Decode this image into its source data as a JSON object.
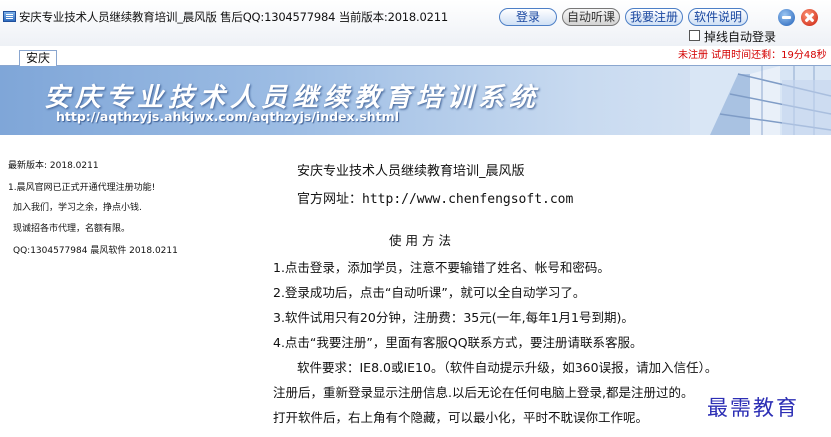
{
  "window": {
    "title": "安庆专业技术人员继续教育培训_晨风版 售后QQ:1304577984 当前版本:2018.0211"
  },
  "toolbar": {
    "login_label": "登录",
    "auto_listen_label": "自动听课",
    "register_label": "我要注册",
    "manual_label": "软件说明"
  },
  "options": {
    "auto_relogin_label": "掉线自动登录",
    "auto_relogin_checked": false
  },
  "status": {
    "trial_notice": "未注册 试用时间还剩：19分48秒"
  },
  "tabs": [
    {
      "label": "安庆",
      "active": true
    }
  ],
  "banner": {
    "title": "安庆专业技术人员继续教育培训系统",
    "url": "http://aqthzyjs.ahkjwx.com/aqthzyjs/index.shtml"
  },
  "sidebar": {
    "lines": [
      "最新版本: 2018.0211",
      "1.晨风官网已正式开通代理注册功能!",
      "加入我们，学习之余，挣点小钱.",
      "现诚招各市代理，名额有限。",
      "QQ:1304577984  晨风软件 2018.0211"
    ]
  },
  "main": {
    "product_heading": "安庆专业技术人员继续教育培训_晨风版",
    "site_label": "官方网址：",
    "site_url": "http://www.chenfengsoft.com",
    "usage_heading": "使用方法",
    "steps": [
      "1.点击登录，添加学员，注意不要输错了姓名、帐号和密码。",
      "2.登录成功后，点击“自动听课”，就可以全自动学习了。",
      "3.软件试用只有20分钟，注册费：35元(一年,每年1月1号到期)。",
      "4.点击“我要注册”，里面有客服QQ联系方式，要注册请联系客服。",
      "软件要求：IE8.0或IE10。（软件自动提示升级，如360误报，请加入信任）。",
      "注册后，重新登录显示注册信息.以后无论在任何电脑上登录,都是注册过的。",
      "打开软件后，右上角有个隐藏，可以最小化，平时不耽误你工作呢。"
    ]
  },
  "watermark": "最需教育",
  "colors": {
    "banner_gradient_start": "#7fa6d8",
    "trial_notice": "#d40000",
    "pill_text": "#1a47a0",
    "watermark": "#2d2fb5"
  },
  "icons": {
    "app": "app-icon",
    "minimize": "minimize-icon",
    "close": "close-icon"
  }
}
